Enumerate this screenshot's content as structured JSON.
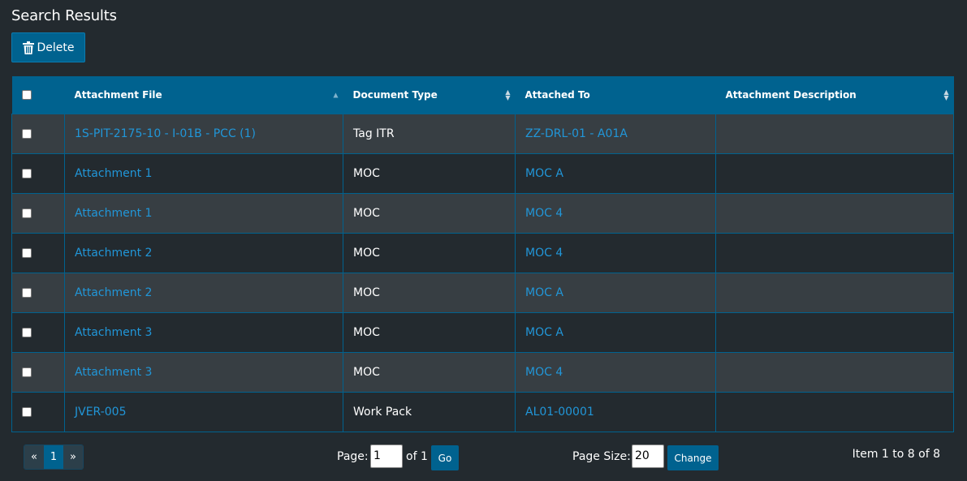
{
  "page": {
    "title": "Search Results"
  },
  "toolbar": {
    "delete_label": "Delete",
    "delete_icon": "trash-icon"
  },
  "colors": {
    "accent": "#00628f",
    "link": "#2196d8",
    "background": "#232a2f",
    "row_alt": "#373e43"
  },
  "table": {
    "columns": [
      {
        "label": "Attachment File",
        "sort": "asc"
      },
      {
        "label": "Document Type",
        "sort": "both"
      },
      {
        "label": "Attached To",
        "sort": "none"
      },
      {
        "label": "Attachment Description",
        "sort": "both"
      }
    ],
    "rows": [
      {
        "file": "1S-PIT-2175-10 - I-01B - PCC (1)",
        "type": "Tag ITR",
        "attached_to": "ZZ-DRL-01 - A01A",
        "description": ""
      },
      {
        "file": "Attachment 1",
        "type": "MOC",
        "attached_to": "MOC A",
        "description": ""
      },
      {
        "file": "Attachment 1",
        "type": "MOC",
        "attached_to": "MOC 4",
        "description": ""
      },
      {
        "file": "Attachment 2",
        "type": "MOC",
        "attached_to": "MOC 4",
        "description": ""
      },
      {
        "file": "Attachment 2",
        "type": "MOC",
        "attached_to": "MOC A",
        "description": ""
      },
      {
        "file": "Attachment 3",
        "type": "MOC",
        "attached_to": "MOC A",
        "description": ""
      },
      {
        "file": "Attachment 3",
        "type": "MOC",
        "attached_to": "MOC 4",
        "description": ""
      },
      {
        "file": "JVER-005",
        "type": "Work Pack",
        "attached_to": "AL01-00001",
        "description": ""
      }
    ]
  },
  "pagination": {
    "prev": "«",
    "current": "1",
    "next": "»",
    "page_label": "Page:",
    "page_value": "1",
    "of_label": "of 1",
    "go_label": "Go",
    "size_label": "Page Size:",
    "size_value": "20",
    "change_label": "Change",
    "summary": "Item 1 to 8 of 8"
  }
}
